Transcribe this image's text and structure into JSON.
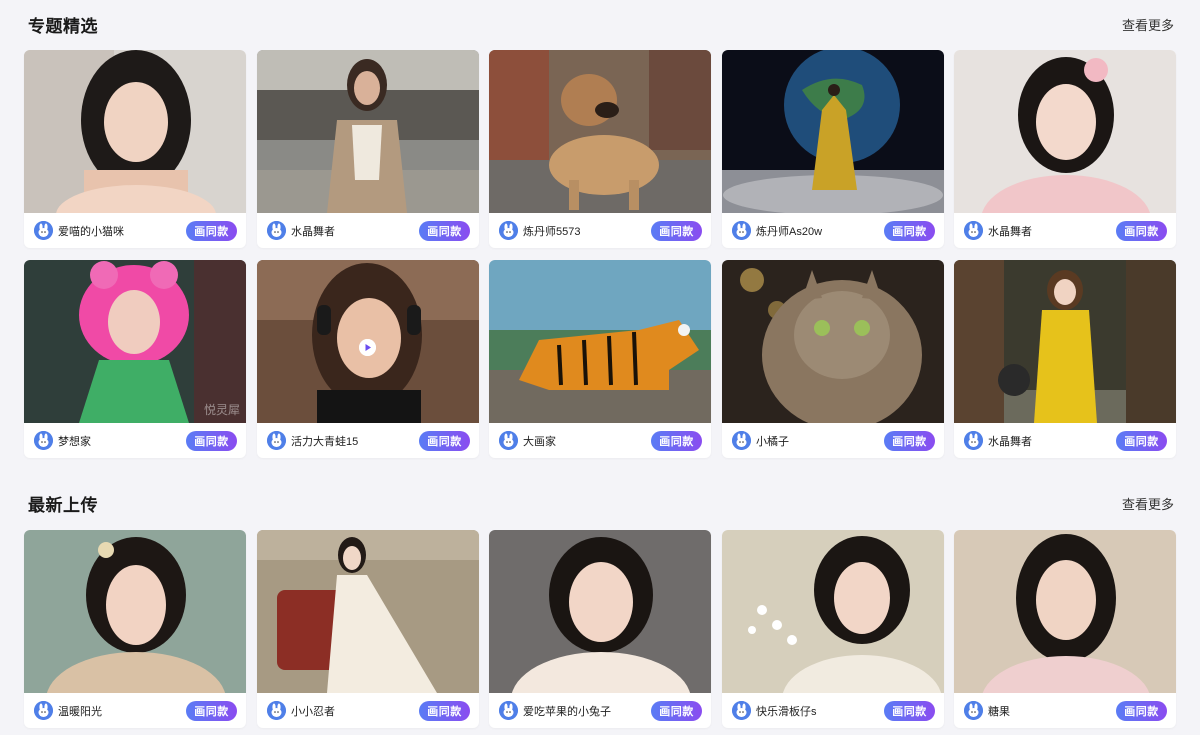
{
  "sections": [
    {
      "title": "专题精选",
      "more_label": "查看更多",
      "cards": [
        {
          "user": "爱喵的小猫咪",
          "button": "画同款",
          "image": "portrait-woman-dark-hair"
        },
        {
          "user": "水晶舞者",
          "button": "画同款",
          "image": "woman-trench-coat-street"
        },
        {
          "user": "炼丹师5573",
          "button": "画同款",
          "image": "fluffy-dog-cobblestone"
        },
        {
          "user": "炼丹师As20w",
          "button": "画同款",
          "image": "woman-yellow-gown-moon-earth"
        },
        {
          "user": "水晶舞者",
          "button": "画同款",
          "image": "woman-flower-hairpin-pink"
        },
        {
          "user": "梦想家",
          "button": "画同款",
          "image": "pink-hair-girl-green-dress",
          "watermark": "悦灵犀"
        },
        {
          "user": "活力大青蛙15",
          "button": "画同款",
          "image": "woman-headphones-video"
        },
        {
          "user": "大画家",
          "button": "画同款",
          "image": "tiger-on-rock"
        },
        {
          "user": "小橘子",
          "button": "画同款",
          "image": "long-haired-cat"
        },
        {
          "user": "水晶舞者",
          "button": "画同款",
          "image": "anime-girl-yellow-raincoat"
        }
      ]
    },
    {
      "title": "最新上传",
      "more_label": "查看更多",
      "cards": [
        {
          "user": "温暖阳光",
          "button": "画同款",
          "image": "woman-hair-flowers-green-bg"
        },
        {
          "user": "小小忍者",
          "button": "画同款",
          "image": "woman-white-dress-red-chair"
        },
        {
          "user": "爱吃苹果的小兔子",
          "button": "画同款",
          "image": "woman-white-blouse-grey-bg"
        },
        {
          "user": "快乐滑板仔s",
          "button": "画同款",
          "image": "woman-holding-white-blossoms"
        },
        {
          "user": "糖果",
          "button": "画同款",
          "image": "woman-pink-top-beige-bg"
        }
      ]
    }
  ],
  "colors": {
    "background": "#f4f4f8",
    "button_gradient_start": "#5a7cf5",
    "button_gradient_end": "#8a4cf0",
    "avatar": "#4f7fe8"
  }
}
